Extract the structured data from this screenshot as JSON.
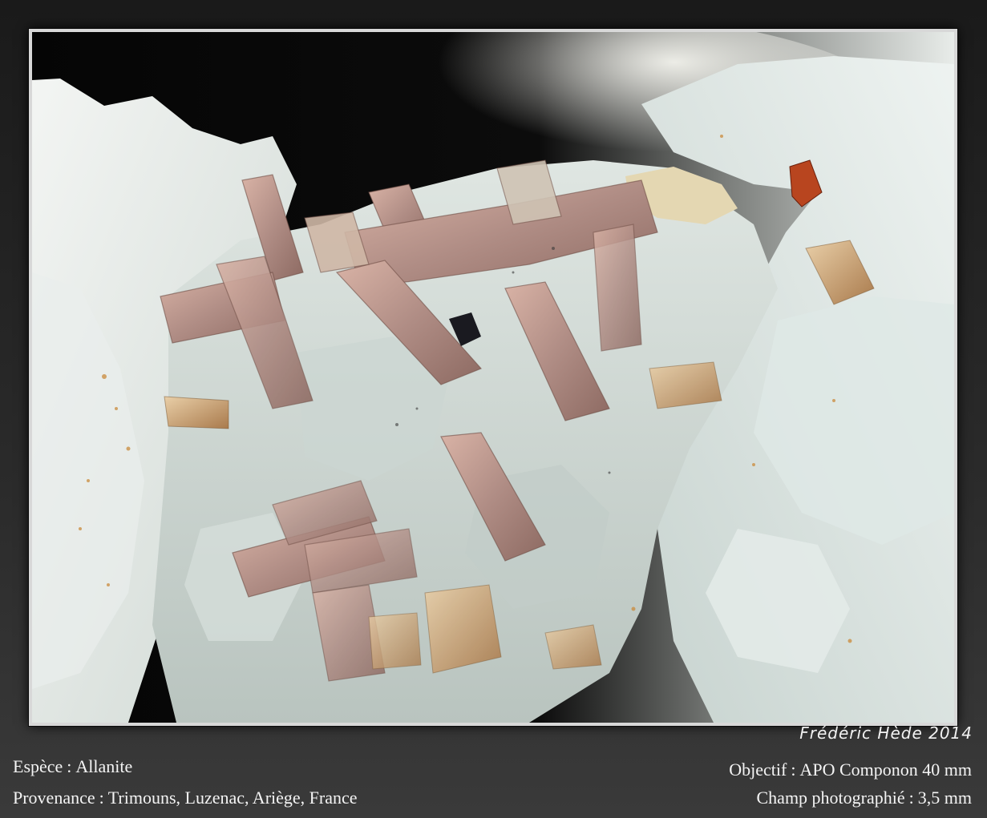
{
  "signature": "Frédéric Hède 2014",
  "captions": {
    "species_label": "Espèce",
    "species_value": "Allanite",
    "provenance_label": "Provenance",
    "provenance_value": "Trimouns, Luzenac, Ariège, France",
    "objective_label": "Objectif",
    "objective_value": "APO Componon 40 mm",
    "field_label": "Champ photographié",
    "field_value": "3,5 mm"
  },
  "colors": {
    "background": "#1e1e1e",
    "caption_text": "#f4f4f4",
    "matrix_white": "#e6ebe8",
    "crystal_pink": "#b88f84",
    "crystal_amber": "#c6935a",
    "inclusion_red": "#b8451f"
  }
}
